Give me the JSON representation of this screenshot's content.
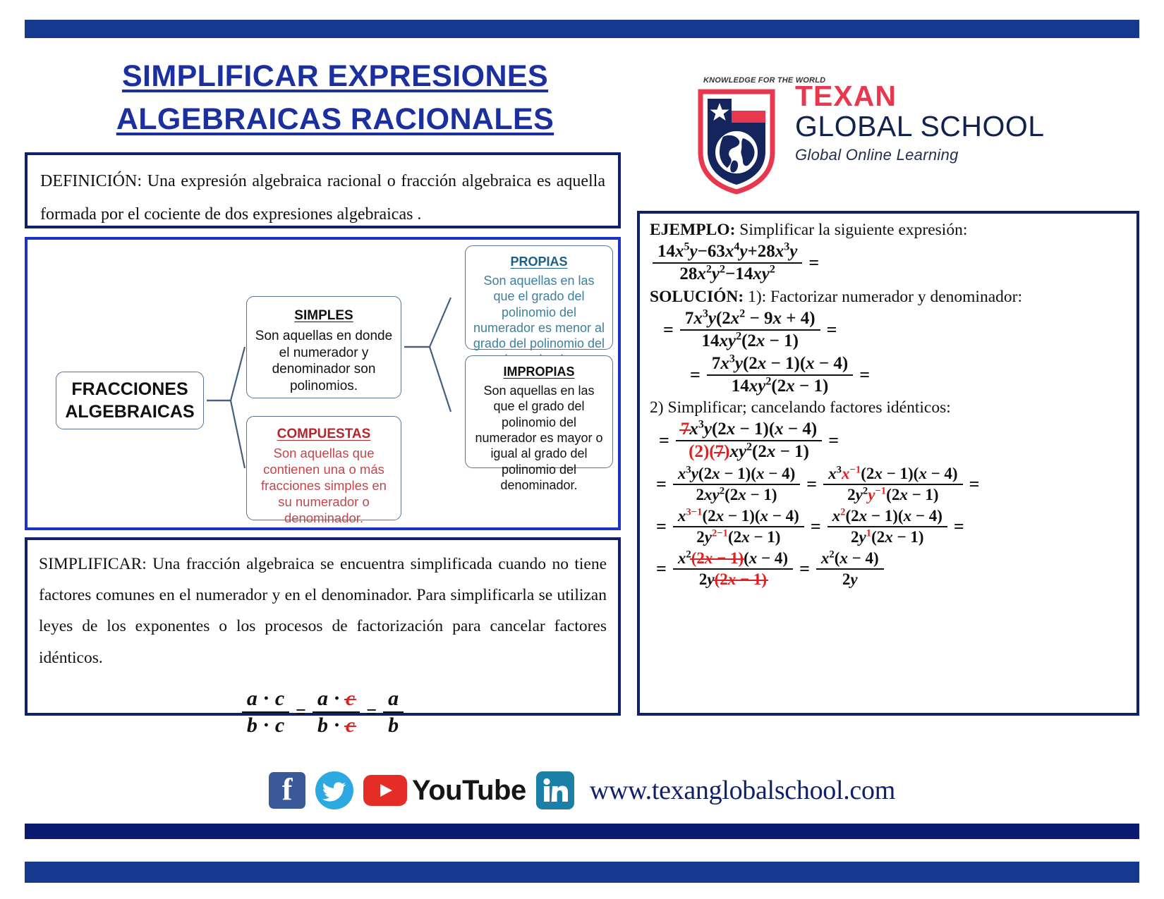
{
  "bands": {
    "top_color": "#15398e",
    "bottom_1_color": "#0a1a6e",
    "bottom_2_color": "#15398e"
  },
  "title": {
    "line1": "SIMPLIFICAR EXPRESIONES",
    "line2": "ALGEBRAICAS RACIONALES",
    "color": "#1b2f9e"
  },
  "logo": {
    "tagline_top": "KNOWLEDGE FOR THE WORLD",
    "name_1": "TEXAN",
    "name_2": "GLOBAL SCHOOL",
    "subtitle": "Global Online Learning",
    "color_texan": "#e8384f",
    "color_global": "#11224e"
  },
  "definicion": {
    "label": "DEFINICIÓN:",
    "text": " Una expresión algebraica racional o fracción algebraica es aquella formada por el cociente de dos expresiones algebraicas ."
  },
  "diagram": {
    "root": {
      "line1": "FRACCIONES",
      "line2": "ALGEBRAICAS"
    },
    "nodes": [
      {
        "id": "simples",
        "header": "SIMPLES",
        "body": "Son aquellas en donde el numerador y denominador son polinomios.",
        "color": "#111111"
      },
      {
        "id": "compuestas",
        "header": "COMPUESTAS",
        "body": "Son aquellas que contienen una o más fracciones simples en su numerador o denominador.",
        "color": "#c2474d"
      },
      {
        "id": "propias",
        "header": "PROPIAS",
        "body": "Son aquellas en las que el grado del polinomio del numerador es menor al grado del polinomio del denominador.",
        "color": "#3f7f9e"
      },
      {
        "id": "impropias",
        "header": "IMPROPIAS",
        "body": "Son aquellas en las que el grado del polinomio del numerador es mayor o igual al grado del polinomio del denominador.",
        "color": "#111111"
      }
    ]
  },
  "simplificar": {
    "label": "SIMPLIFICAR:",
    "text": " Una fracción algebraica se encuentra simplificada cuando no tiene factores comunes en el numerador y en el denominador. Para simplificarla se utilizan leyes de los exponentes o los procesos de factorización para cancelar factores idénticos.",
    "formula_plain": "(a·c)/(b·c) = (a·c̶)/(b·c̶) = a/b"
  },
  "ejemplo": {
    "label": "EJEMPLO:",
    "prompt": " Simplificar la siguiente expresión:",
    "expression_plain": "(14x^5 y − 63x^4 y + 28x^3 y) / (28x^2 y^2 − 14xy^2) =",
    "solucion_label": "SOLUCIÓN:",
    "step1": "  1): Factorizar numerador y denominador:",
    "step1_a_plain": "= 7x^3 y(2x^2 − 9x + 4) / 14xy^2(2x − 1) =",
    "step1_b_plain": "= 7x^3 y(2x − 1)(x − 4) / 14xy^2(2x − 1) =",
    "step2": "2) Simplificar; cancelando factores idénticos:",
    "step2_a_plain": "= 7̶x^3 y(2x − 1)(x − 4) / (2)(7̶)xy^2(2x − 1) =",
    "step2_b_plain": "= x^3 y(2x − 1)(x − 4) / 2xy^2(2x − 1) = x^3 x^-1 (2x − 1)(x − 4) / 2y^2 y^-1 (2x − 1) =",
    "step2_c_plain": "= x^(3−1)(2x − 1)(x − 4) / 2y^(2−1)(2x − 1) = x^2(2x − 1)(x − 4) / 2y^1(2x − 1) =",
    "step2_d_plain": "= x^2 (2̶x̶ ̶−̶ ̶1̶)(x − 4) / 2y(2̶x̶ ̶−̶ ̶1̶) = x^2(x − 4) / 2y",
    "cancel_color": "#e02020"
  },
  "footer": {
    "facebook": "facebook-icon",
    "twitter": "twitter-icon",
    "youtube_badge": "youtube-icon",
    "youtube_word": "YouTube",
    "linkedin": "linkedin-icon",
    "url": "www.texanglobalschool.com"
  }
}
